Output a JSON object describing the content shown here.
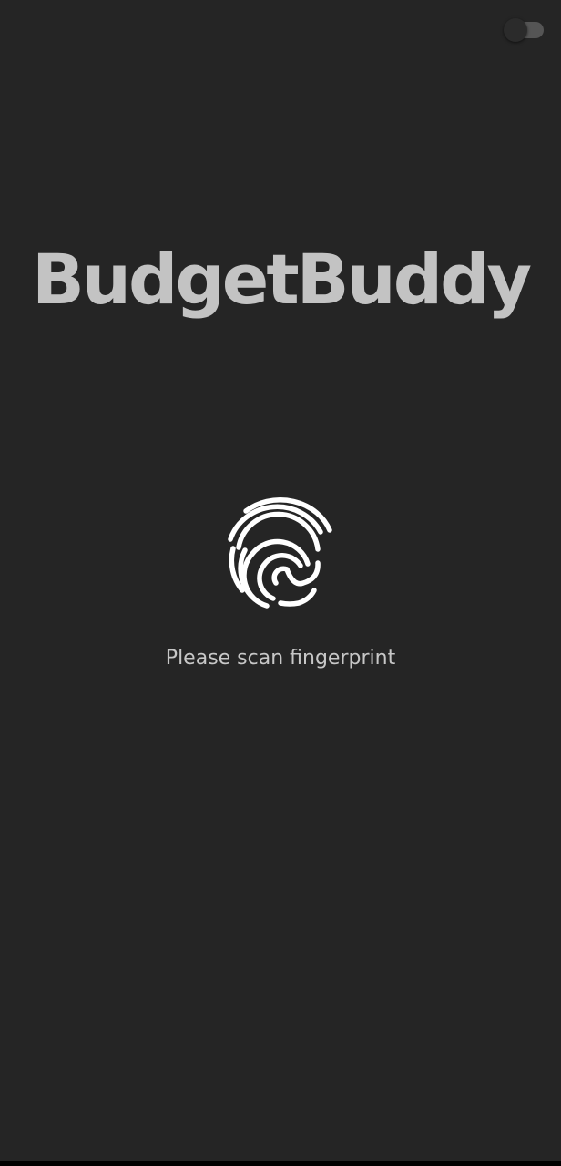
{
  "app": {
    "title": "BudgetBuddy"
  },
  "theme_toggle": {
    "state": "off"
  },
  "auth": {
    "prompt": "Please scan fingerprint",
    "icon": "fingerprint-icon"
  },
  "colors": {
    "background": "#252525",
    "title": "#c3c3c3",
    "prompt": "#c7c7c7",
    "icon": "#ffffff",
    "toggle_track": "#555555"
  }
}
